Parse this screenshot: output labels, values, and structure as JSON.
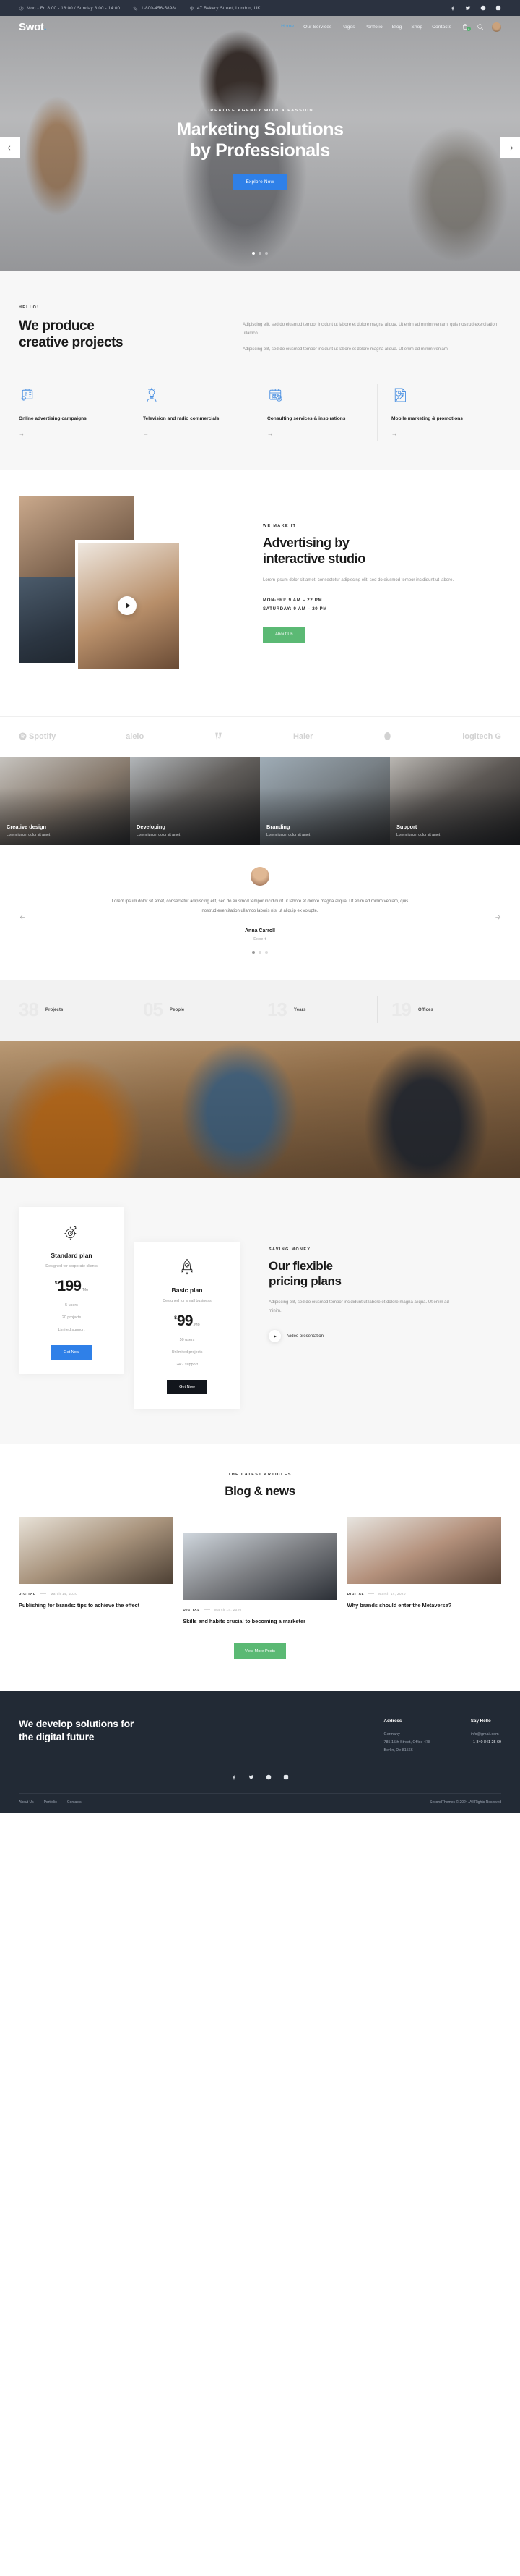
{
  "topbar": {
    "hours": "Mon - Fri 8:00 - 18:00 / Sunday 8:00 - 14:00",
    "phone": "1-800-456-5898/",
    "address": "47 Bakery Street, London, UK",
    "social": [
      "facebook-icon",
      "twitter-icon",
      "dribbble-icon",
      "instagram-icon"
    ]
  },
  "nav": {
    "brand": "Swot",
    "brand_dot": ".",
    "items": [
      {
        "label": "Home",
        "active": true
      },
      {
        "label": "Our Services",
        "active": false
      },
      {
        "label": "Pages",
        "active": false
      },
      {
        "label": "Portfolio",
        "active": false
      },
      {
        "label": "Blog",
        "active": false
      },
      {
        "label": "Shop",
        "active": false
      },
      {
        "label": "Contacts",
        "active": false
      }
    ],
    "cart_count": "0"
  },
  "hero": {
    "eyebrow": "CREATIVE AGENCY WITH A PASSION",
    "title_line1": "Marketing Solutions",
    "title_line2": "by Professionals",
    "button": "Explore Now"
  },
  "produce": {
    "eyebrow": "HELLO!",
    "title_line1": "We produce",
    "title_line2": "creative projects",
    "paragraph1": "Adipiscing elit, sed do eiusmod tempor incidunt ut labore et dolore magna aliqua. Ut enim ad minim veniam, quis nostrud exercitation ullamco.",
    "paragraph2": "Adipiscing elit, sed do eiusmod tempor incidunt ut labore et dolore magna aliqua. Ut enim ad minim veniam.",
    "features": [
      {
        "icon": "briefcase-gear-icon",
        "title": "Online advertising campaigns",
        "arrow": "→"
      },
      {
        "icon": "lightbulb-person-icon",
        "title": "Television and radio commercials",
        "arrow": "→"
      },
      {
        "icon": "calendar-chart-icon",
        "title": "Consulting services & inspirations",
        "arrow": "→"
      },
      {
        "icon": "document-piechart-icon",
        "title": "Mobile marketing & promotions",
        "arrow": "→"
      }
    ]
  },
  "advertising": {
    "eyebrow": "WE MAKE IT",
    "title_line1": "Advertising by",
    "title_line2": "interactive studio",
    "paragraph": "Lorem ipsum dolor sit amet, consectetur adipiscing elit, sed do eiusmod tempor incididunt ut labore.",
    "hours_weekday": "MON-FRI: 9 AM – 22 PM",
    "hours_saturday": "SATURDAY: 9 AM – 20 PM",
    "button": "About Us"
  },
  "logos": [
    "Spotify",
    "alelo",
    "Adobe",
    "Haier",
    "B",
    "logitech G"
  ],
  "cards": [
    {
      "title": "Creative design",
      "subtitle": "Lorem ipsum dolor sit amet"
    },
    {
      "title": "Developing",
      "subtitle": "Lorem ipsum dolor sit amet"
    },
    {
      "title": "Branding",
      "subtitle": "Lorem ipsum dolor sit amet"
    },
    {
      "title": "Support",
      "subtitle": "Lorem ipsum dolor sit amet"
    }
  ],
  "testimonial": {
    "quote": "Lorem ipsum dolor sit amet, consectetur adipiscing elit, sed do eiusmod tempor incididunt ut labore et dolore magna aliqua. Ut enim ad minim veniam, quis nostrud exercitation ullamco laboris nisi ut aliquip ex volupte.",
    "name": "Anna Carroll",
    "role": "Expert"
  },
  "counters": [
    {
      "number": "38",
      "label": "Projects"
    },
    {
      "number": "05",
      "label": "People"
    },
    {
      "number": "13",
      "label": "Years"
    },
    {
      "number": "19",
      "label": "Offices"
    }
  ],
  "pricing": {
    "eyebrow": "SAVING MONEY",
    "title_line1": "Our flexible",
    "title_line2": "pricing plans",
    "paragraph": "Adipiscing elit, sed do eiusmod tempor incididunt ut labore et dolore magna aliqua. Ut enim ad minim.",
    "video_label": "Video presentation",
    "plans": [
      {
        "icon": "target-gear-icon",
        "title": "Standard plan",
        "subtitle": "Designed for corporate clients",
        "currency": "$",
        "price": "199",
        "period": "/Mo",
        "features": [
          "5 users",
          "20 projects",
          "Limited support"
        ],
        "button": "Get Now",
        "button_style": "blue"
      },
      {
        "icon": "rocket-icon",
        "title": "Basic plan",
        "subtitle": "Designed for small business",
        "currency": "$",
        "price": "99",
        "period": "/Mo",
        "features": [
          "50 users",
          "Unlimited projects",
          "24/7 support"
        ],
        "button": "Get Now",
        "button_style": "dark"
      }
    ]
  },
  "blog": {
    "eyebrow": "THE LATEST ARTICLES",
    "title": "Blog & news",
    "button": "View More Posts",
    "posts": [
      {
        "category": "DIGITAL",
        "date": "March 14, 2020",
        "title": "Publishing for brands: tips to achieve the effect"
      },
      {
        "category": "DIGITAL",
        "date": "March 14, 2020",
        "title": "Skills and habits crucial to becoming a marketer"
      },
      {
        "category": "DIGITAL",
        "date": "March 14, 2020",
        "title": "Why brands should enter the Metaverse?"
      }
    ]
  },
  "footer": {
    "heading_line1": "We develop solutions for",
    "heading_line2": "the digital future",
    "address_title": "Address",
    "address_lines": [
      "Germany —",
      "785 15th Street, Office 478",
      "Berlin, De 81566"
    ],
    "contact_title": "Say Hello",
    "contact_email": "info@gmail.com",
    "contact_phone": "+1 840 841 25 69",
    "social": [
      "facebook-icon",
      "twitter-icon",
      "dribbble-icon",
      "instagram-icon"
    ],
    "nav": [
      "About Us",
      "Portfolio",
      "Contacts"
    ],
    "copyright": "SecondThemes © 2024. All Rights Reserved"
  }
}
